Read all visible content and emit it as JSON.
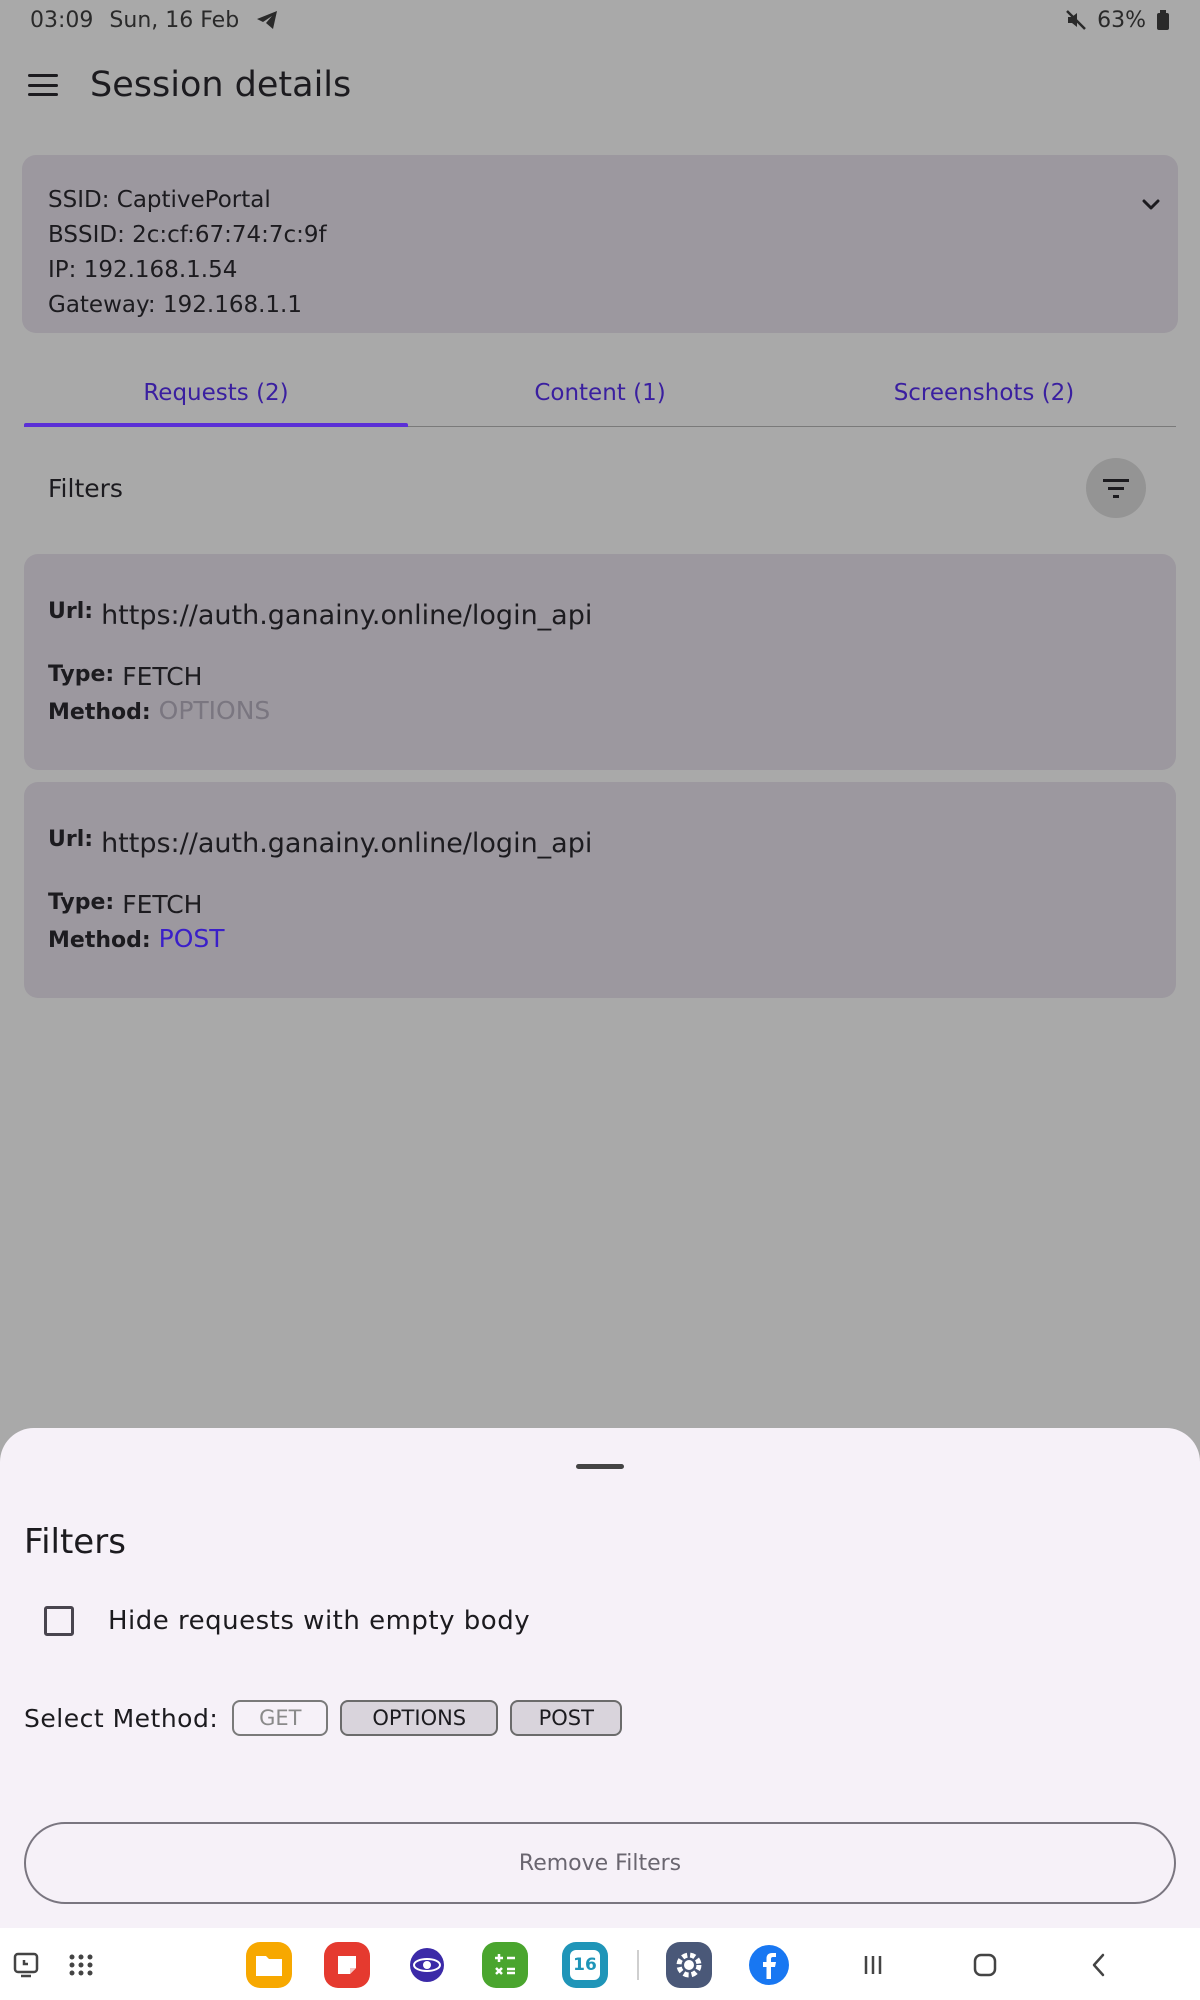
{
  "status_bar": {
    "time": "03:09",
    "date": "Sun, 16 Feb",
    "battery": "63%",
    "icons": [
      "telegram-icon",
      "mute-icon",
      "battery-icon"
    ]
  },
  "app_bar": {
    "title": "Session details"
  },
  "session_info": {
    "ssid": "SSID: CaptivePortal",
    "bssid": "BSSID: 2c:cf:67:74:7c:9f",
    "ip": "IP: 192.168.1.54",
    "gateway": "Gateway: 192.168.1.1"
  },
  "tabs": [
    {
      "label": "Requests (2)",
      "active": true
    },
    {
      "label": "Content (1)",
      "active": false
    },
    {
      "label": "Screenshots (2)",
      "active": false
    }
  ],
  "filters_row": {
    "label": "Filters"
  },
  "requests": [
    {
      "url_key": "Url:",
      "url": "https://auth.ganainy.online/login_api",
      "type_key": "Type:",
      "type": "FETCH",
      "method_key": "Method:",
      "method": "OPTIONS"
    },
    {
      "url_key": "Url:",
      "url": "https://auth.ganainy.online/login_api",
      "type_key": "Type:",
      "type": "FETCH",
      "method_key": "Method:",
      "method": "POST"
    }
  ],
  "filter_sheet": {
    "title": "Filters",
    "hide_empty_label": "Hide requests with empty body",
    "hide_empty_checked": false,
    "select_method_label": "Select Method:",
    "methods": [
      "GET",
      "OPTIONS",
      "POST"
    ],
    "selected_methods": [
      "OPTIONS",
      "POST"
    ],
    "remove_button": "Remove Filters"
  },
  "navbar": {
    "apps": [
      "files-app-icon",
      "notes-app-icon",
      "galaxy-app-icon",
      "calculator-app-icon",
      "calendar-app-icon",
      "settings-app-icon",
      "facebook-app-icon"
    ],
    "calendar_day": "16"
  },
  "colors": {
    "accent": "#5b2fd6",
    "tab_text": "#3a1fa0",
    "post_method": "#3a1fc9",
    "options_method": "#7a7680",
    "card_bg": "#9c989f",
    "sheet_bg": "#f6f1f8"
  }
}
